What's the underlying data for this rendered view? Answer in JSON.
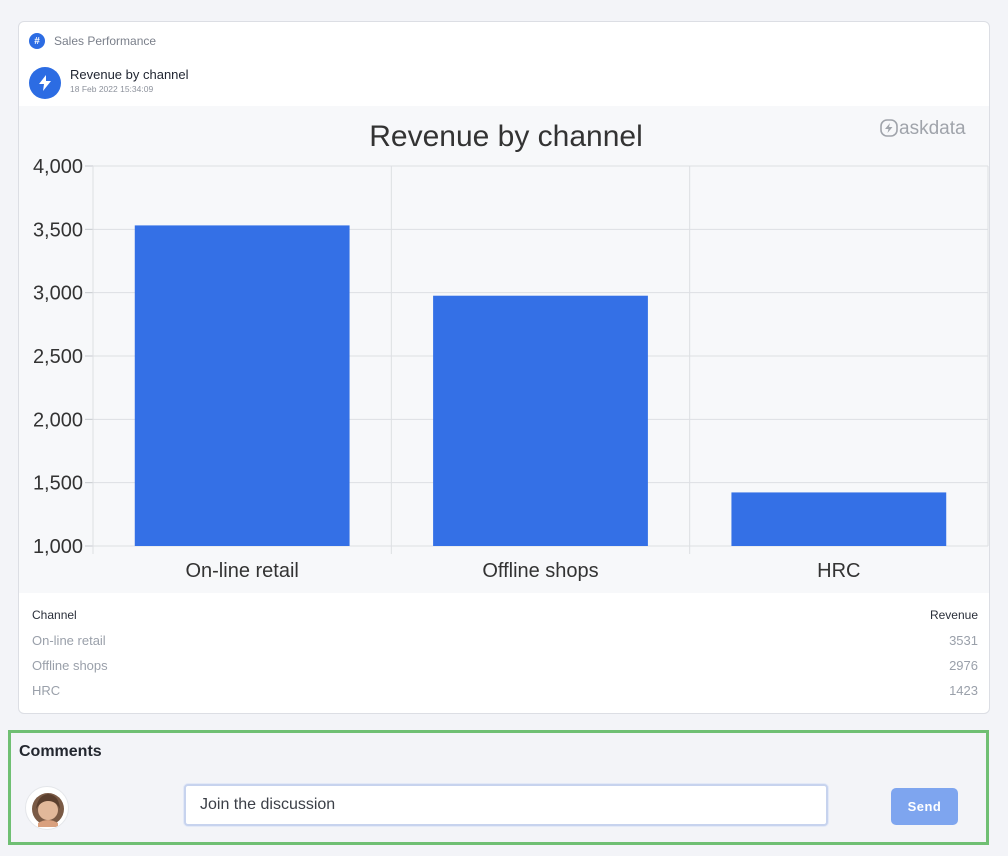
{
  "breadcrumb": {
    "label": "Sales Performance",
    "icon": "hash-icon"
  },
  "post": {
    "title": "Revenue by channel",
    "timestamp": "18 Feb 2022 15:34:09",
    "icon": "lightning-bolt-icon"
  },
  "brand": {
    "name": "askdata",
    "logo_icon": "askdata-logo-icon"
  },
  "chart_data": {
    "type": "bar",
    "title": "Revenue by channel",
    "categories": [
      "On-line retail",
      "Offline shops",
      "HRC"
    ],
    "values": [
      3531,
      2976,
      1423
    ],
    "xlabel": "",
    "ylabel": "",
    "ylim": [
      1000,
      4000
    ],
    "yticks": [
      "1,000",
      "1,500",
      "2,000",
      "2,500",
      "3,000",
      "3,500",
      "4,000"
    ],
    "grid": true,
    "bar_color": "#3470e6"
  },
  "table": {
    "headers": [
      "Channel",
      "Revenue"
    ],
    "rows": [
      [
        "On-line retail",
        "3531"
      ],
      [
        "Offline shops",
        "2976"
      ],
      [
        "HRC",
        "1423"
      ]
    ]
  },
  "comments": {
    "title": "Comments",
    "placeholder": "Join the discussion",
    "send_label": "Send",
    "avatar_icon": "user-avatar-icon"
  },
  "colors": {
    "accent": "#2c6ce3",
    "bar": "#3470e6",
    "send_button": "#7ea5ef",
    "highlight_border": "#6fbf73"
  }
}
